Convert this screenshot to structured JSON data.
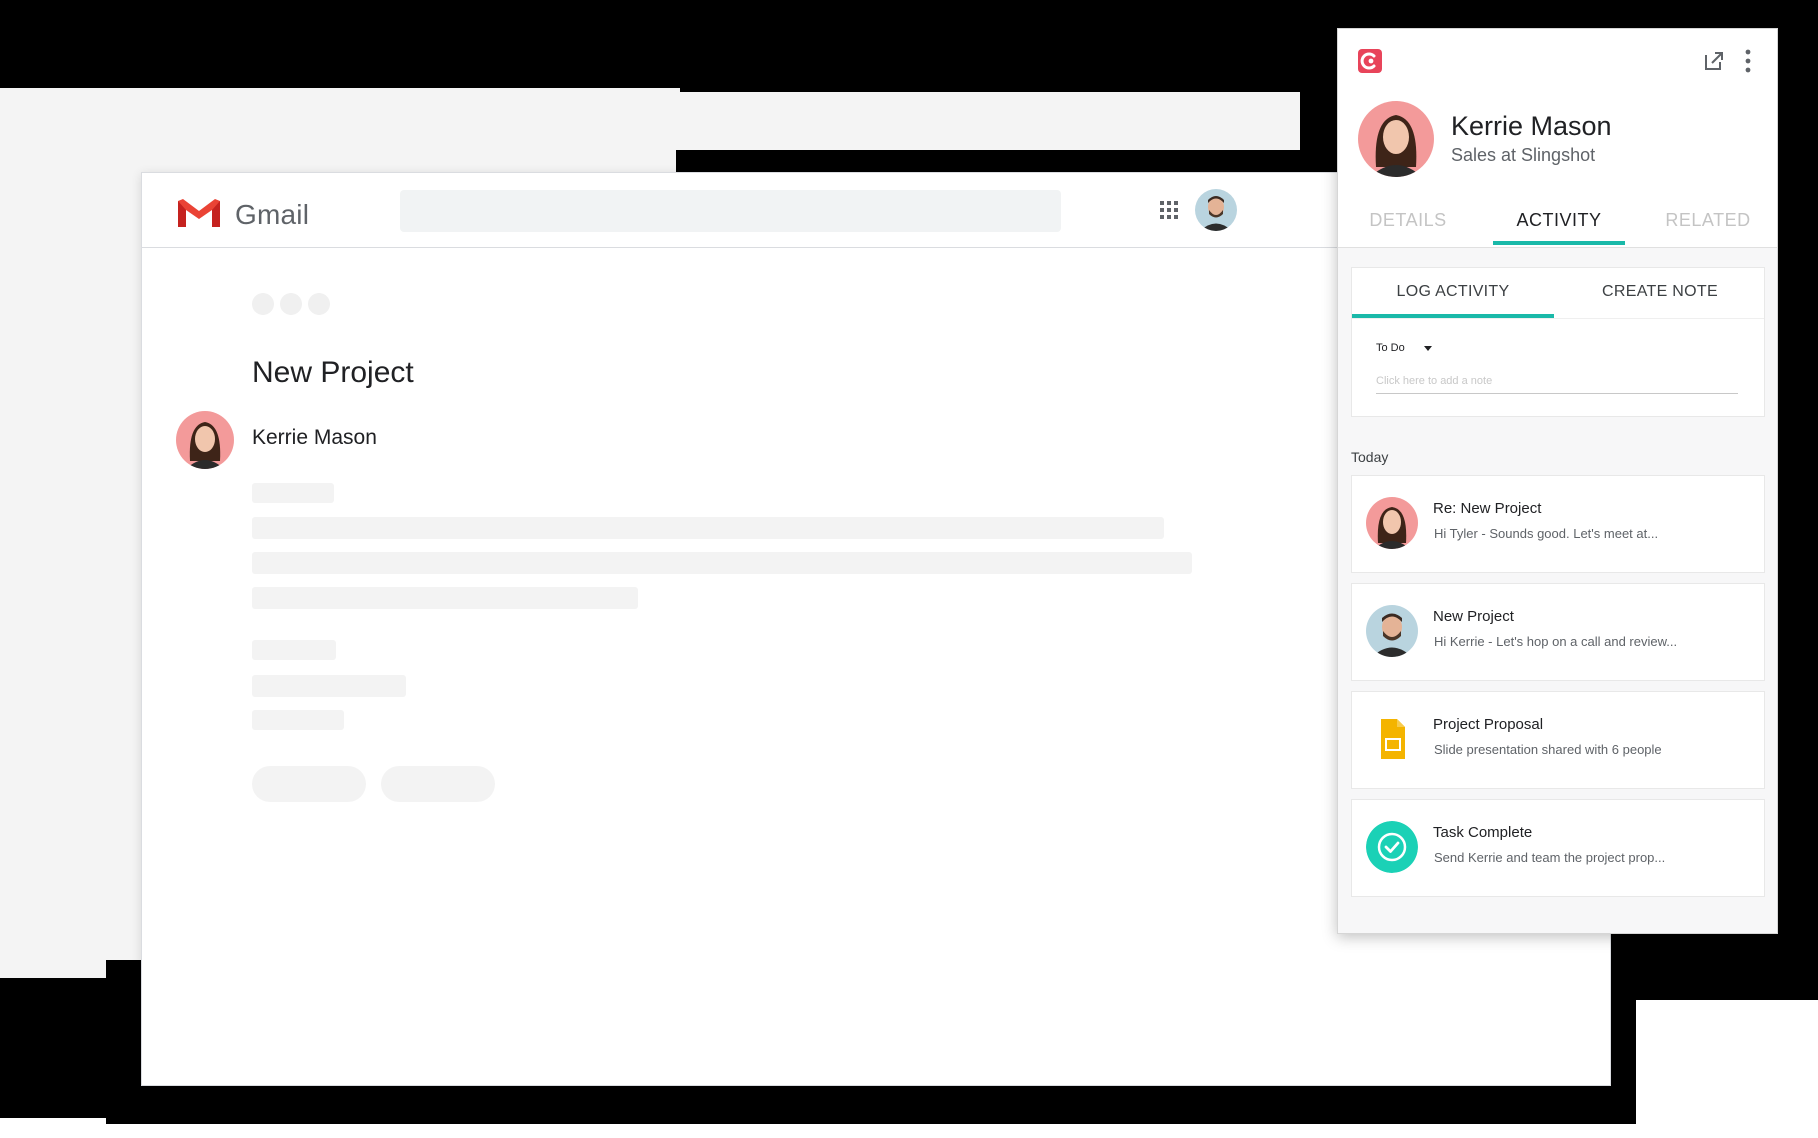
{
  "gmail": {
    "brand": "Gmail",
    "search_placeholder": "",
    "thread": {
      "subject": "New Project",
      "sender_name": "Kerrie Mason"
    },
    "icons": {
      "logo": "gmail-m-logo",
      "apps": "apps-grid-icon",
      "account": "account-avatar"
    }
  },
  "crm": {
    "contact": {
      "name": "Kerrie Mason",
      "title": "Sales at Slingshot"
    },
    "tabs": [
      {
        "label": "DETAILS",
        "active": false
      },
      {
        "label": "ACTIVITY",
        "active": true
      },
      {
        "label": "RELATED",
        "active": false
      }
    ],
    "log": {
      "tabs": [
        {
          "label": "LOG ACTIVITY",
          "active": true
        },
        {
          "label": "CREATE NOTE",
          "active": false
        }
      ],
      "type_value": "To Do",
      "note_placeholder": "Click here to add a note"
    },
    "section_label": "Today",
    "activities": [
      {
        "title": "Re: New Project",
        "snippet": "Hi Tyler -  Sounds good. Let's meet at...",
        "icon": "contact-avatar-kerrie"
      },
      {
        "title": "New Project",
        "snippet": "Hi Kerrie - Let's hop on a call and review...",
        "icon": "contact-avatar-tyler"
      },
      {
        "title": "Project Proposal",
        "snippet": "Slide presentation shared with 6 people",
        "icon": "slides-file-icon"
      },
      {
        "title": "Task Complete",
        "snippet": "Send Kerrie and team the project prop...",
        "icon": "check-circle-icon"
      }
    ],
    "colors": {
      "accent": "#1ab9a9",
      "brand": "#e8445a",
      "slides": "#f4b400",
      "task_complete": "#1bd1b6"
    },
    "icons": {
      "logo": "crm-logo-icon",
      "open_external": "open-in-new-icon",
      "more": "more-vert-icon"
    }
  }
}
